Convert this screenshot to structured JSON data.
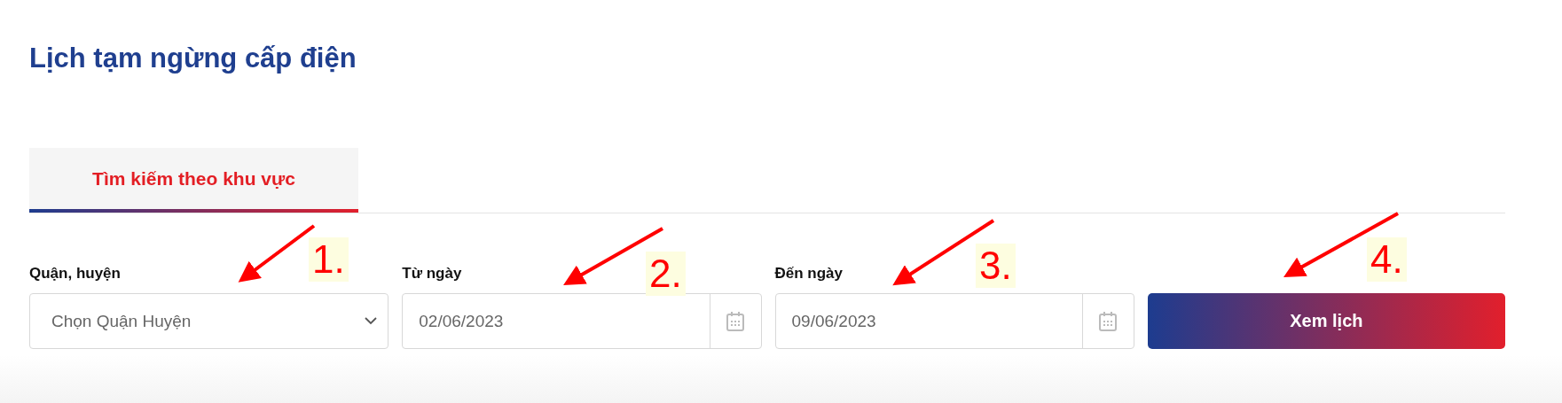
{
  "title": "Lịch tạm ngừng cấp điện",
  "tabs": [
    {
      "label": "Tìm kiếm theo khu vực",
      "selected": true
    }
  ],
  "fields": [
    {
      "kind": "select",
      "label": "Quận, huyện",
      "placeholder": "Chọn Quận Huyện"
    },
    {
      "kind": "date",
      "label": "Từ ngày",
      "value": "02/06/2023"
    },
    {
      "kind": "date",
      "label": "Đến ngày",
      "value": "09/06/2023"
    }
  ],
  "button": "Xem lịch",
  "annotations": [
    {
      "label": "1."
    },
    {
      "label": "2."
    },
    {
      "label": "3."
    },
    {
      "label": "4."
    }
  ]
}
